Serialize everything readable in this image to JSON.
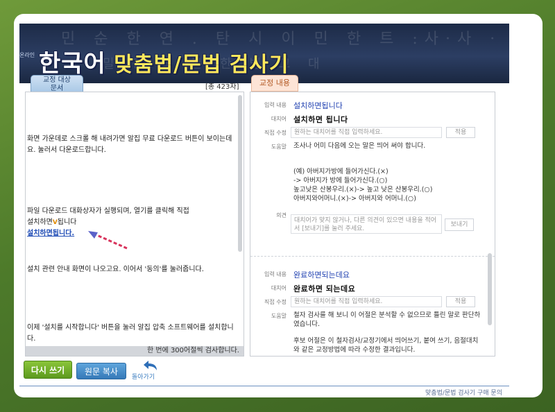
{
  "banner": {
    "bg_text_1": "민 순 한 연 . 탄 시 이 민 한 트   :사·사 · 서울 무 니 이 文 나",
    "bg_text_2": "밀 청 특 본 한 법 고 대",
    "small_prefix": "온라인",
    "title_main": "한국어",
    "title_hl": "맞춤법/문법 검사기"
  },
  "left": {
    "tab_label": "교정 대상\n문서",
    "char_count": "[총 423자]",
    "para1": "화면 가운데로 스크롤 해 내려가면 알집 무료 다운로드 버튼이 보이는데요. 눌러서 다운로드합니다.",
    "para2_line1": "파일 다운로드 대화상자가 실행되며, 열기를 클릭해 직접",
    "para2_line2_a": "설치하면",
    "para2_mark": "V",
    "para2_line2_b": "됩니다",
    "para2_error": "설치하면됩니다.",
    "para3": "설치 관련 안내 화면이 나오고요. 이어서 '동의'를 눌러줍니다.",
    "para4": "이제 '설치를 시작합니다' 버튼을 눌러 알집 압축 소프트웨어를 설치합니다.",
    "footer": "한 번에 300어절씩 검사합니다."
  },
  "right": {
    "tab_label": "교정 내용",
    "labels": {
      "input": "입력 내용",
      "replace": "대치어",
      "direct": "직접 수정",
      "help": "도움말",
      "opinion": "의견"
    },
    "apply_label": "적용",
    "send_label": "보내기",
    "edit_placeholder": "원하는 대치어를 직접 입력하세요.",
    "opinion_placeholder": "대치어가 맞지 않거나, 다른 의견이 있으면 내용을 적어서 [보내기]를 눌러 주세요.",
    "item1": {
      "input": "설치하면됩니다",
      "replace": "설치하면 됩니다",
      "help1": "조사나 어미 다음에 오는 말은 띄어 써야 합니다.",
      "ex1": "(예) 아버지가방에 들어가신다.(×)",
      "ex2": "-> 아버지가 방에 들어가신다.(○)",
      "ex3": "높고낮은 산봉우리.(×)-> 높고 낮은 산봉우리.(○)",
      "ex4": "아버지와어머니.(×)-> 아버지와 어머니.(○)"
    },
    "item2": {
      "input": "완료하면되는데요",
      "replace": "완료하면 되는데요",
      "help1": "철자 검사를 해 보니 이 어절은 분석할 수 없으므로 틀린 말로 판단하였습니다.",
      "help2": "후보 어절은 이 철자검사/교정기에서 띄어쓰기, 붙여 쓰기, 음절대치와 같은 교정방법에 따라 수정한 결과입니다."
    }
  },
  "buttons": {
    "rewrite": "다시 쓰기",
    "copy": "원문 복사",
    "back": "돌아가기"
  },
  "bottom_link": "맞춤법/문법 검사기 구매 문의"
}
